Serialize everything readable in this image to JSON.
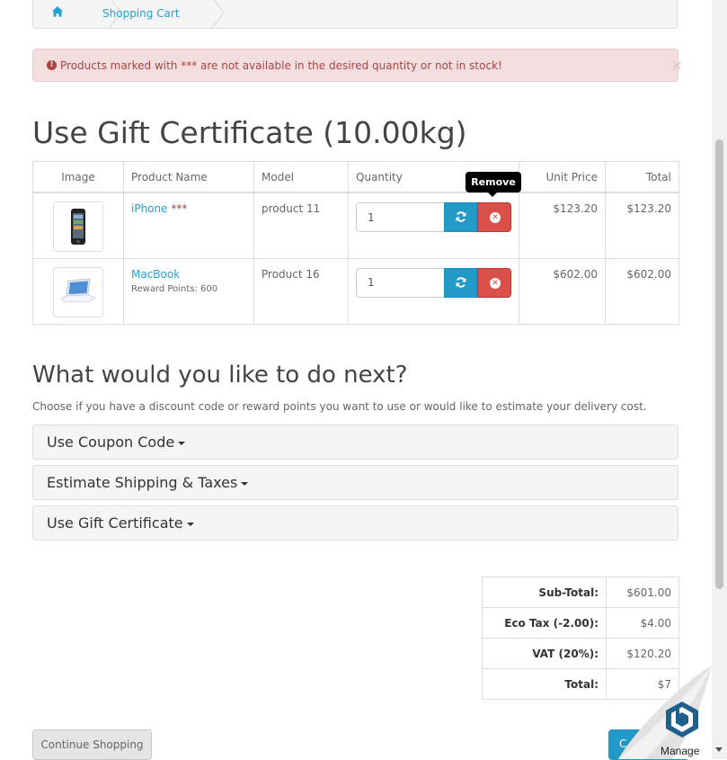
{
  "breadcrumb": {
    "home_icon": "home-icon",
    "current": "Shopping Cart"
  },
  "alert": {
    "icon": "exclamation-circle-icon",
    "message": "Products marked with *** are not available in the desired quantity or not in stock!",
    "close": "×"
  },
  "page_title": "Use Gift Certificate  (10.00kg)",
  "cart": {
    "headers": [
      "Image",
      "Product Name",
      "Model",
      "Quantity",
      "Unit Price",
      "Total"
    ],
    "items": [
      {
        "name": "iPhone",
        "stock_flag": "***",
        "reward": "",
        "model": "product 11",
        "quantity": "1",
        "unit_price": "$123.20",
        "total": "$123.20",
        "image": "iphone-image"
      },
      {
        "name": "MacBook",
        "stock_flag": "",
        "reward": "Reward Points: 600",
        "model": "Product 16",
        "quantity": "1",
        "unit_price": "$602.00",
        "total": "$602.00",
        "image": "macbook-image"
      }
    ],
    "update_icon": "refresh-icon",
    "remove_icon": "times-circle-icon",
    "tooltip": "Remove"
  },
  "next": {
    "title": "What would you like to do next?",
    "description": "Choose if you have a discount code or reward points you want to use or would like to estimate your delivery cost.",
    "panels": [
      "Use Coupon Code",
      "Estimate Shipping & Taxes",
      "Use Gift Certificate"
    ]
  },
  "totals": [
    {
      "label": "Sub-Total:",
      "value": "$601.00"
    },
    {
      "label": "Eco Tax (-2.00):",
      "value": "$4.00"
    },
    {
      "label": "VAT (20%):",
      "value": "$120.20"
    },
    {
      "label": "Total:",
      "value": "$7"
    }
  ],
  "buttons": {
    "continue": "Continue Shopping",
    "checkout": "C"
  },
  "widget": {
    "label": "Manage",
    "icon": "hexagon-b-logo-icon"
  },
  "colors": {
    "link": "#23a1d1",
    "primary": "#229ac8",
    "danger": "#da4f49",
    "alert_bg": "#f2dede",
    "alert_text": "#a94442"
  }
}
